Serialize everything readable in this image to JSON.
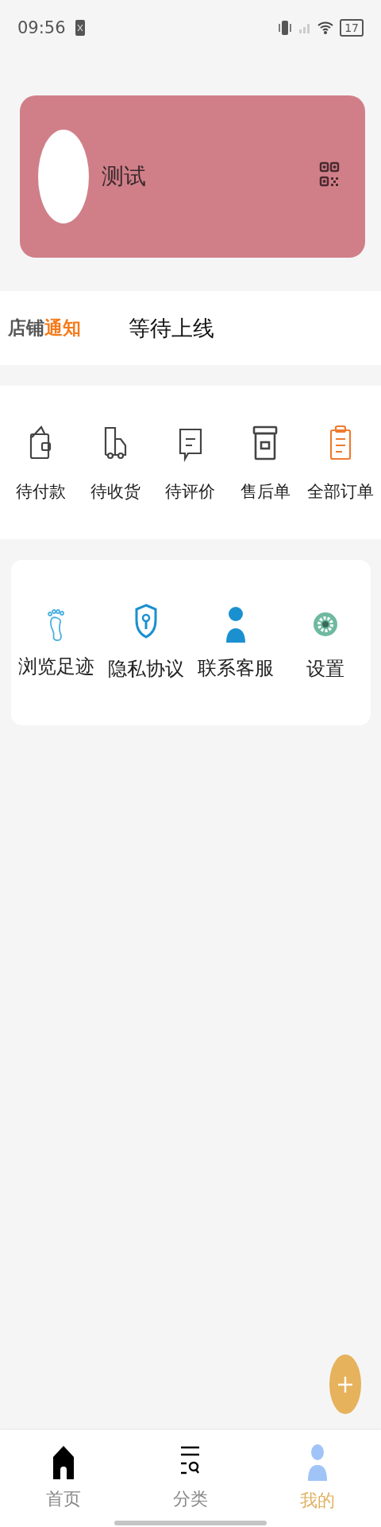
{
  "status_bar": {
    "time": "09:56",
    "battery": "17"
  },
  "profile": {
    "name": "测试"
  },
  "notice": {
    "logo_dark": "店铺",
    "logo_accent": "通知",
    "text": "等待上线"
  },
  "orders": [
    {
      "kind": "wallet",
      "label": "待付款"
    },
    {
      "kind": "truck",
      "label": "待收货"
    },
    {
      "kind": "comment",
      "label": "待评价"
    },
    {
      "kind": "box",
      "label": "售后单"
    },
    {
      "kind": "clipboard",
      "label": "全部订单"
    }
  ],
  "services": [
    {
      "kind": "footprint",
      "label": "浏览足迹"
    },
    {
      "kind": "shield",
      "label": "隐私协议"
    },
    {
      "kind": "person",
      "label": "联系客服"
    },
    {
      "kind": "gear",
      "label": "设置"
    }
  ],
  "tabs": [
    {
      "kind": "home",
      "label": "首页",
      "selected": false
    },
    {
      "kind": "category",
      "label": "分类",
      "selected": false
    },
    {
      "kind": "me",
      "label": "我的",
      "selected": true
    }
  ]
}
